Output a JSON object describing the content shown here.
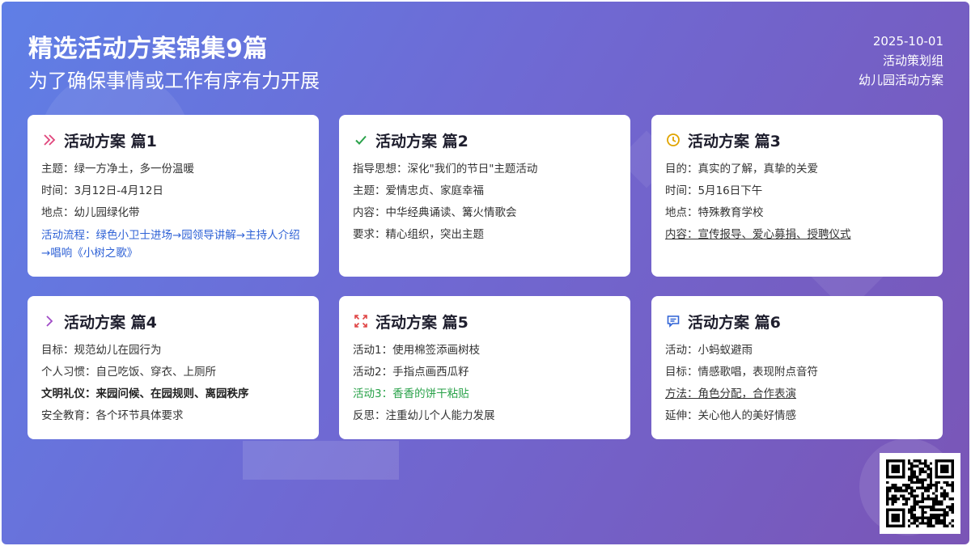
{
  "header": {
    "title": "精选活动方案锦集9篇",
    "subtitle": "为了确保事情或工作有序有力开展",
    "date": "2025-10-01",
    "author": "活动策划组",
    "category": "幼儿园活动方案"
  },
  "cards": [
    {
      "title": "活动方案 篇1",
      "icon": "double-chevron-right-icon",
      "icon_color": "#e0457b",
      "lines": [
        "主题：绿一方净土，多一份温暖",
        "时间：3月12日-4月12日",
        "地点：幼儿园绿化带",
        "活动流程：绿色小卫士进场→园领导讲解→主持人介绍→唱响《小树之歌》"
      ]
    },
    {
      "title": "活动方案 篇2",
      "icon": "check-icon",
      "icon_color": "#2aa24a",
      "lines": [
        "指导思想：深化\"我们的节日\"主题活动",
        "主题：爱情忠贞、家庭幸福",
        "内容：中华经典诵读、篝火情歌会",
        "要求：精心组织，突出主题"
      ]
    },
    {
      "title": "活动方案 篇3",
      "icon": "clock-icon",
      "icon_color": "#e0a400",
      "lines": [
        "目的：真实的了解，真挚的关爱",
        "时间：5月16日下午",
        "地点：特殊教育学校",
        "内容：宣传报导、爱心募捐、授聘仪式"
      ]
    },
    {
      "title": "活动方案 篇4",
      "icon": "chevron-right-icon",
      "icon_color": "#a04bc6",
      "lines": [
        "目标：规范幼儿在园行为",
        "个人习惯：自己吃饭、穿衣、上厕所",
        "文明礼仪：来园问候、在园规则、离园秩序",
        "安全教育：各个环节具体要求"
      ]
    },
    {
      "title": "活动方案 篇5",
      "icon": "expand-icon",
      "icon_color": "#e04545",
      "lines": [
        "活动1：使用棉签添画树枝",
        "活动2：手指点画西瓜籽",
        "活动3：香香的饼干粘贴",
        "反思：注重幼儿个人能力发展"
      ]
    },
    {
      "title": "活动方案 篇6",
      "icon": "chat-icon",
      "icon_color": "#2f62d6",
      "lines": [
        "活动：小蚂蚁避雨",
        "目标：情感歌唱，表现附点音符",
        "方法：角色分配，合作表演",
        "延伸：关心他人的美好情感"
      ]
    }
  ]
}
